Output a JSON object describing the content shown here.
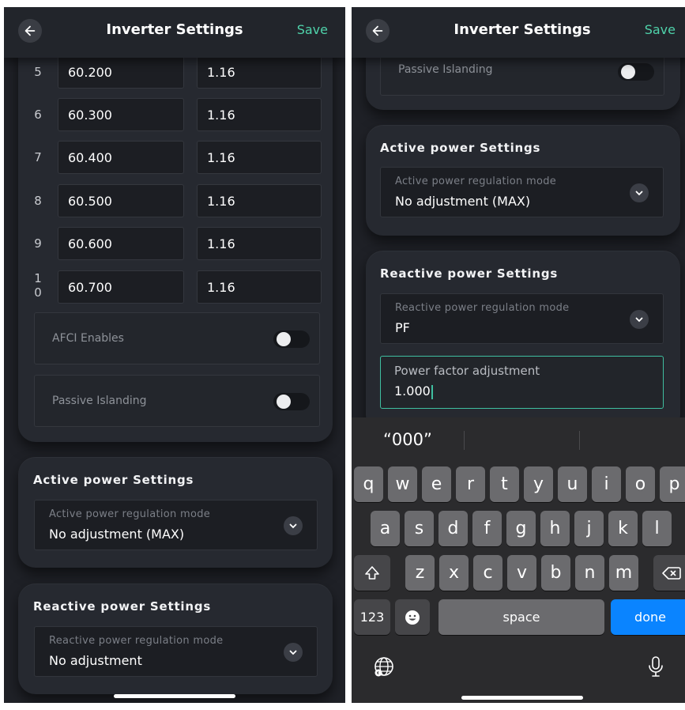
{
  "left_screen": {
    "header": {
      "title": "Inverter Settings",
      "save_label": "Save",
      "back_icon": "arrow-left-icon"
    },
    "table_rows": [
      {
        "index": "5",
        "value": "60.200",
        "time": "1.16"
      },
      {
        "index": "6",
        "value": "60.300",
        "time": "1.16"
      },
      {
        "index": "7",
        "value": "60.400",
        "time": "1.16"
      },
      {
        "index": "8",
        "value": "60.500",
        "time": "1.16"
      },
      {
        "index": "9",
        "value": "60.600",
        "time": "1.16"
      },
      {
        "index": "10",
        "index_line1": "1",
        "index_line2": "0",
        "value": "60.700",
        "time": "1.16"
      }
    ],
    "afci": {
      "label": "AFCI Enables",
      "on": false
    },
    "passive_islanding": {
      "label": "Passive Islanding",
      "on": false
    },
    "active_power": {
      "title": "Active power Settings",
      "mode_label": "Active power regulation mode",
      "mode_value": "No adjustment (MAX)"
    },
    "reactive_power": {
      "title": "Reactive power Settings",
      "mode_label": "Reactive power regulation mode",
      "mode_value": "No adjustment"
    }
  },
  "right_screen": {
    "header": {
      "title": "Inverter Settings",
      "save_label": "Save",
      "back_icon": "arrow-left-icon"
    },
    "passive_islanding": {
      "label": "Passive Islanding",
      "on": false
    },
    "active_power": {
      "title": "Active power Settings",
      "mode_label": "Active power regulation mode",
      "mode_value": "No adjustment (MAX)"
    },
    "reactive_power": {
      "title": "Reactive power Settings",
      "mode_label": "Reactive power regulation mode",
      "mode_value": "PF",
      "pf_label": "Power factor adjustment",
      "pf_value": "1.000"
    },
    "keyboard": {
      "suggestion": "“000”",
      "row1": [
        "q",
        "w",
        "e",
        "r",
        "t",
        "y",
        "u",
        "i",
        "o",
        "p"
      ],
      "row2": [
        "a",
        "s",
        "d",
        "f",
        "g",
        "h",
        "j",
        "k",
        "l"
      ],
      "row3": [
        "z",
        "x",
        "c",
        "v",
        "b",
        "n",
        "m"
      ],
      "numbers_key": "123",
      "space_key": "space",
      "done_key": "done"
    }
  },
  "colors": {
    "accent": "#4fd2aa",
    "focus_border": "#3fbfa0",
    "background": "#1f2127",
    "card": "#262930",
    "keyboard_done": "#0a84ff"
  }
}
